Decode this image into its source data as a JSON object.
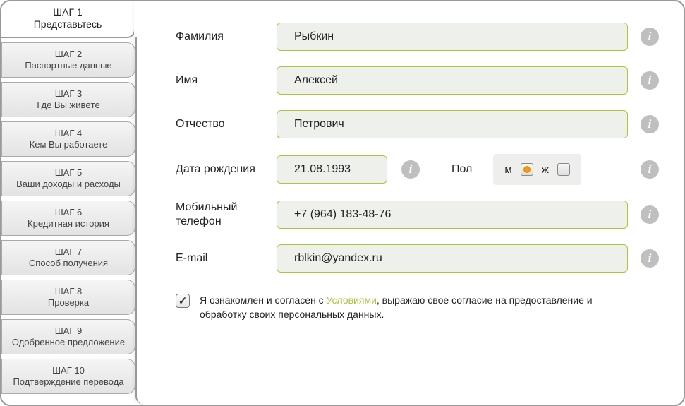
{
  "sidebar": {
    "steps": [
      {
        "num": "ШАГ 1",
        "label": "Представьтесь"
      },
      {
        "num": "ШАГ 2",
        "label": "Паспортные данные"
      },
      {
        "num": "ШАГ 3",
        "label": "Где Вы живёте"
      },
      {
        "num": "ШАГ 4",
        "label": "Кем Вы работаете"
      },
      {
        "num": "ШАГ 5",
        "label": "Ваши доходы и расходы"
      },
      {
        "num": "ШАГ 6",
        "label": "Кредитная история"
      },
      {
        "num": "ШАГ 7",
        "label": "Способ получения"
      },
      {
        "num": "ШАГ 8",
        "label": "Проверка"
      },
      {
        "num": "ШАГ 9",
        "label": "Одобренное предложение"
      },
      {
        "num": "ШАГ 10",
        "label": "Подтверждение перевода"
      }
    ],
    "active_index": 0
  },
  "form": {
    "lastname_label": "Фамилия",
    "lastname_value": "Рыбкин",
    "firstname_label": "Имя",
    "firstname_value": "Алексей",
    "patronymic_label": "Отчество",
    "patronymic_value": "Петрович",
    "dob_label": "Дата рождения",
    "dob_value": "21.08.1993",
    "gender_label": "Пол",
    "gender_options": {
      "male": "м",
      "female": "ж"
    },
    "gender_selected": "male",
    "phone_label": "Мобильный телефон",
    "phone_value": "+7 (964) 183-48-76",
    "email_label": "E-mail",
    "email_value": "rblkin@yandex.ru"
  },
  "consent": {
    "checked": true,
    "text_before": "Я ознакомлен и согласен с ",
    "link": "Условиями",
    "text_after": ", выражаю свое согласие на предоставление и обработку своих персональных данных."
  }
}
